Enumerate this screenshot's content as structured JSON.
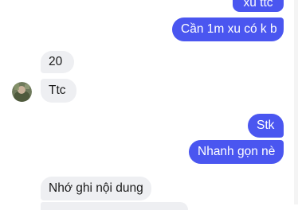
{
  "conversation": {
    "messages": [
      {
        "sender": "me",
        "text": "xu ttc"
      },
      {
        "sender": "me",
        "text": "Cần 1m xu có k b"
      },
      {
        "sender": "contact",
        "text": "20"
      },
      {
        "sender": "contact",
        "text": "Ttc"
      },
      {
        "sender": "me",
        "text": "Stk"
      },
      {
        "sender": "me",
        "text": "Nhanh gọn nè"
      },
      {
        "sender": "contact",
        "text": "Nhớ ghi nội dung"
      }
    ]
  },
  "contact": {
    "avatar_icon": "contact-avatar"
  },
  "colors": {
    "outgoing_bubble": "#4a56f0",
    "incoming_bubble": "#eeeff2",
    "background": "#ffffff"
  }
}
